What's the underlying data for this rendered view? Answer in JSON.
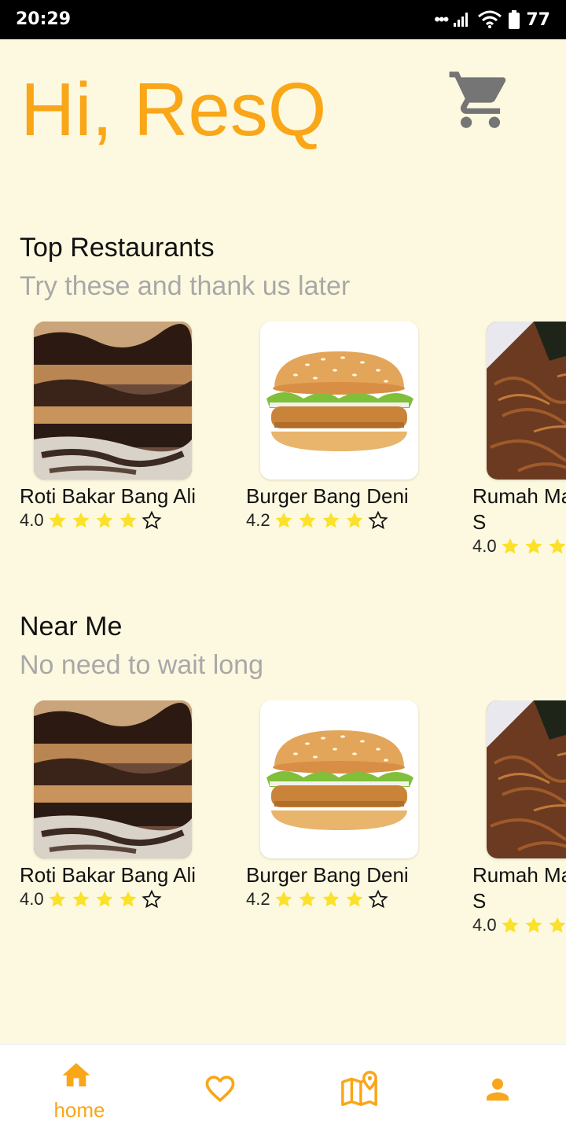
{
  "status_bar": {
    "time": "20:29",
    "battery": "77"
  },
  "header": {
    "greeting": "Hi, ResQ"
  },
  "sections": [
    {
      "title": "Top Restaurants",
      "subtitle": "Try these and thank us later",
      "items": [
        {
          "name": "Roti Bakar Bang Ali",
          "rating": "4.0",
          "stars": 4,
          "image": "toast"
        },
        {
          "name": "Burger Bang Deni",
          "rating": "4.2",
          "stars": 4,
          "image": "burger"
        },
        {
          "name": "Rumah Makan Padang S",
          "rating": "4.0",
          "stars": 4,
          "image": "fried"
        }
      ]
    },
    {
      "title": "Near Me",
      "subtitle": "No need to wait long",
      "items": [
        {
          "name": "Roti Bakar Bang Ali",
          "rating": "4.0",
          "stars": 4,
          "image": "toast"
        },
        {
          "name": "Burger Bang Deni",
          "rating": "4.2",
          "stars": 4,
          "image": "burger"
        },
        {
          "name": "Rumah Makan Padang S",
          "rating": "4.0",
          "stars": 4,
          "image": "fried"
        }
      ]
    }
  ],
  "nav": [
    {
      "label": "home",
      "icon": "home-icon",
      "active": true
    },
    {
      "label": "",
      "icon": "heart-icon",
      "active": false
    },
    {
      "label": "",
      "icon": "map-icon",
      "active": false
    },
    {
      "label": "",
      "icon": "person-icon",
      "active": false
    }
  ],
  "colors": {
    "accent": "#f9a618",
    "background": "#fdf9e0",
    "star": "#fbe12a"
  }
}
